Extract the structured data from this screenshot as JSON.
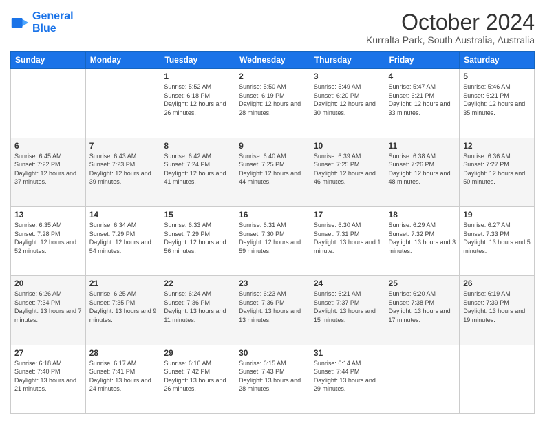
{
  "header": {
    "logo_line1": "General",
    "logo_line2": "Blue",
    "month": "October 2024",
    "location": "Kurralta Park, South Australia, Australia"
  },
  "weekdays": [
    "Sunday",
    "Monday",
    "Tuesday",
    "Wednesday",
    "Thursday",
    "Friday",
    "Saturday"
  ],
  "weeks": [
    [
      {
        "day": "",
        "sunrise": "",
        "sunset": "",
        "daylight": ""
      },
      {
        "day": "",
        "sunrise": "",
        "sunset": "",
        "daylight": ""
      },
      {
        "day": "1",
        "sunrise": "Sunrise: 5:52 AM",
        "sunset": "Sunset: 6:18 PM",
        "daylight": "Daylight: 12 hours and 26 minutes."
      },
      {
        "day": "2",
        "sunrise": "Sunrise: 5:50 AM",
        "sunset": "Sunset: 6:19 PM",
        "daylight": "Daylight: 12 hours and 28 minutes."
      },
      {
        "day": "3",
        "sunrise": "Sunrise: 5:49 AM",
        "sunset": "Sunset: 6:20 PM",
        "daylight": "Daylight: 12 hours and 30 minutes."
      },
      {
        "day": "4",
        "sunrise": "Sunrise: 5:47 AM",
        "sunset": "Sunset: 6:21 PM",
        "daylight": "Daylight: 12 hours and 33 minutes."
      },
      {
        "day": "5",
        "sunrise": "Sunrise: 5:46 AM",
        "sunset": "Sunset: 6:21 PM",
        "daylight": "Daylight: 12 hours and 35 minutes."
      }
    ],
    [
      {
        "day": "6",
        "sunrise": "Sunrise: 6:45 AM",
        "sunset": "Sunset: 7:22 PM",
        "daylight": "Daylight: 12 hours and 37 minutes."
      },
      {
        "day": "7",
        "sunrise": "Sunrise: 6:43 AM",
        "sunset": "Sunset: 7:23 PM",
        "daylight": "Daylight: 12 hours and 39 minutes."
      },
      {
        "day": "8",
        "sunrise": "Sunrise: 6:42 AM",
        "sunset": "Sunset: 7:24 PM",
        "daylight": "Daylight: 12 hours and 41 minutes."
      },
      {
        "day": "9",
        "sunrise": "Sunrise: 6:40 AM",
        "sunset": "Sunset: 7:25 PM",
        "daylight": "Daylight: 12 hours and 44 minutes."
      },
      {
        "day": "10",
        "sunrise": "Sunrise: 6:39 AM",
        "sunset": "Sunset: 7:25 PM",
        "daylight": "Daylight: 12 hours and 46 minutes."
      },
      {
        "day": "11",
        "sunrise": "Sunrise: 6:38 AM",
        "sunset": "Sunset: 7:26 PM",
        "daylight": "Daylight: 12 hours and 48 minutes."
      },
      {
        "day": "12",
        "sunrise": "Sunrise: 6:36 AM",
        "sunset": "Sunset: 7:27 PM",
        "daylight": "Daylight: 12 hours and 50 minutes."
      }
    ],
    [
      {
        "day": "13",
        "sunrise": "Sunrise: 6:35 AM",
        "sunset": "Sunset: 7:28 PM",
        "daylight": "Daylight: 12 hours and 52 minutes."
      },
      {
        "day": "14",
        "sunrise": "Sunrise: 6:34 AM",
        "sunset": "Sunset: 7:29 PM",
        "daylight": "Daylight: 12 hours and 54 minutes."
      },
      {
        "day": "15",
        "sunrise": "Sunrise: 6:33 AM",
        "sunset": "Sunset: 7:29 PM",
        "daylight": "Daylight: 12 hours and 56 minutes."
      },
      {
        "day": "16",
        "sunrise": "Sunrise: 6:31 AM",
        "sunset": "Sunset: 7:30 PM",
        "daylight": "Daylight: 12 hours and 59 minutes."
      },
      {
        "day": "17",
        "sunrise": "Sunrise: 6:30 AM",
        "sunset": "Sunset: 7:31 PM",
        "daylight": "Daylight: 13 hours and 1 minute."
      },
      {
        "day": "18",
        "sunrise": "Sunrise: 6:29 AM",
        "sunset": "Sunset: 7:32 PM",
        "daylight": "Daylight: 13 hours and 3 minutes."
      },
      {
        "day": "19",
        "sunrise": "Sunrise: 6:27 AM",
        "sunset": "Sunset: 7:33 PM",
        "daylight": "Daylight: 13 hours and 5 minutes."
      }
    ],
    [
      {
        "day": "20",
        "sunrise": "Sunrise: 6:26 AM",
        "sunset": "Sunset: 7:34 PM",
        "daylight": "Daylight: 13 hours and 7 minutes."
      },
      {
        "day": "21",
        "sunrise": "Sunrise: 6:25 AM",
        "sunset": "Sunset: 7:35 PM",
        "daylight": "Daylight: 13 hours and 9 minutes."
      },
      {
        "day": "22",
        "sunrise": "Sunrise: 6:24 AM",
        "sunset": "Sunset: 7:36 PM",
        "daylight": "Daylight: 13 hours and 11 minutes."
      },
      {
        "day": "23",
        "sunrise": "Sunrise: 6:23 AM",
        "sunset": "Sunset: 7:36 PM",
        "daylight": "Daylight: 13 hours and 13 minutes."
      },
      {
        "day": "24",
        "sunrise": "Sunrise: 6:21 AM",
        "sunset": "Sunset: 7:37 PM",
        "daylight": "Daylight: 13 hours and 15 minutes."
      },
      {
        "day": "25",
        "sunrise": "Sunrise: 6:20 AM",
        "sunset": "Sunset: 7:38 PM",
        "daylight": "Daylight: 13 hours and 17 minutes."
      },
      {
        "day": "26",
        "sunrise": "Sunrise: 6:19 AM",
        "sunset": "Sunset: 7:39 PM",
        "daylight": "Daylight: 13 hours and 19 minutes."
      }
    ],
    [
      {
        "day": "27",
        "sunrise": "Sunrise: 6:18 AM",
        "sunset": "Sunset: 7:40 PM",
        "daylight": "Daylight: 13 hours and 21 minutes."
      },
      {
        "day": "28",
        "sunrise": "Sunrise: 6:17 AM",
        "sunset": "Sunset: 7:41 PM",
        "daylight": "Daylight: 13 hours and 24 minutes."
      },
      {
        "day": "29",
        "sunrise": "Sunrise: 6:16 AM",
        "sunset": "Sunset: 7:42 PM",
        "daylight": "Daylight: 13 hours and 26 minutes."
      },
      {
        "day": "30",
        "sunrise": "Sunrise: 6:15 AM",
        "sunset": "Sunset: 7:43 PM",
        "daylight": "Daylight: 13 hours and 28 minutes."
      },
      {
        "day": "31",
        "sunrise": "Sunrise: 6:14 AM",
        "sunset": "Sunset: 7:44 PM",
        "daylight": "Daylight: 13 hours and 29 minutes."
      },
      {
        "day": "",
        "sunrise": "",
        "sunset": "",
        "daylight": ""
      },
      {
        "day": "",
        "sunrise": "",
        "sunset": "",
        "daylight": ""
      }
    ]
  ]
}
